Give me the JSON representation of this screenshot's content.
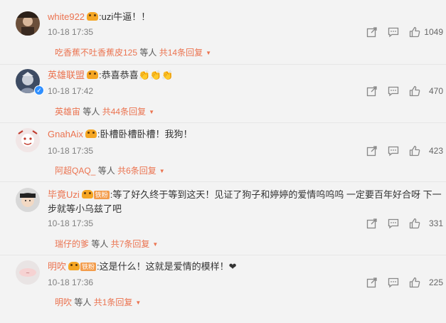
{
  "comments": [
    {
      "user": "white922",
      "badge": "crown",
      "text": ":uzi牛逼！！",
      "time": "10-18 17:35",
      "likes": "1049",
      "reply_user": "吃香蕉不吐香蕉皮125",
      "reply_mid": "等人",
      "reply_total": "共14条回复"
    },
    {
      "user": "英雄联盟",
      "badge": "crown",
      "verified": true,
      "text": ":恭喜恭喜👏👏👏",
      "time": "10-18 17:42",
      "likes": "470",
      "reply_user": "英雄宙",
      "reply_mid": "等人",
      "reply_total": "共44条回复"
    },
    {
      "user": "GnahAix",
      "badge": "crown",
      "text": ":卧槽卧槽卧槽！我狗！",
      "time": "10-18 17:35",
      "likes": "423",
      "reply_user": "阿超QAQ_",
      "reply_mid": "等人",
      "reply_total": "共6条回复"
    },
    {
      "user": "毕竟Uzi",
      "badge": "crown",
      "fan_badge": "铁粉",
      "text": ":等了好久终于等到这天！见证了狗子和婷婷的爱情呜呜呜 一定要百年好合呀 下一步就等小乌兹了吧",
      "time": "10-18 17:35",
      "likes": "331",
      "reply_user": "瑞仔的爹",
      "reply_mid": "等人",
      "reply_total": "共7条回复"
    },
    {
      "user": "明吹",
      "badge": "crown",
      "fan_badge": "铁粉",
      "text": ":这是什么！这就是爱情的模样！❤",
      "time": "10-18 17:36",
      "likes": "225",
      "reply_user": "明吹",
      "reply_mid": "等人",
      "reply_total": "共1条回复"
    }
  ],
  "colors": {
    "username": "#eb7350",
    "background": "#f3f3f3",
    "meta": "#808080"
  },
  "icons": [
    "share-icon",
    "comment-icon",
    "like-icon",
    "verified-icon",
    "vip-crown-icon",
    "dropdown-arrow-icon"
  ]
}
